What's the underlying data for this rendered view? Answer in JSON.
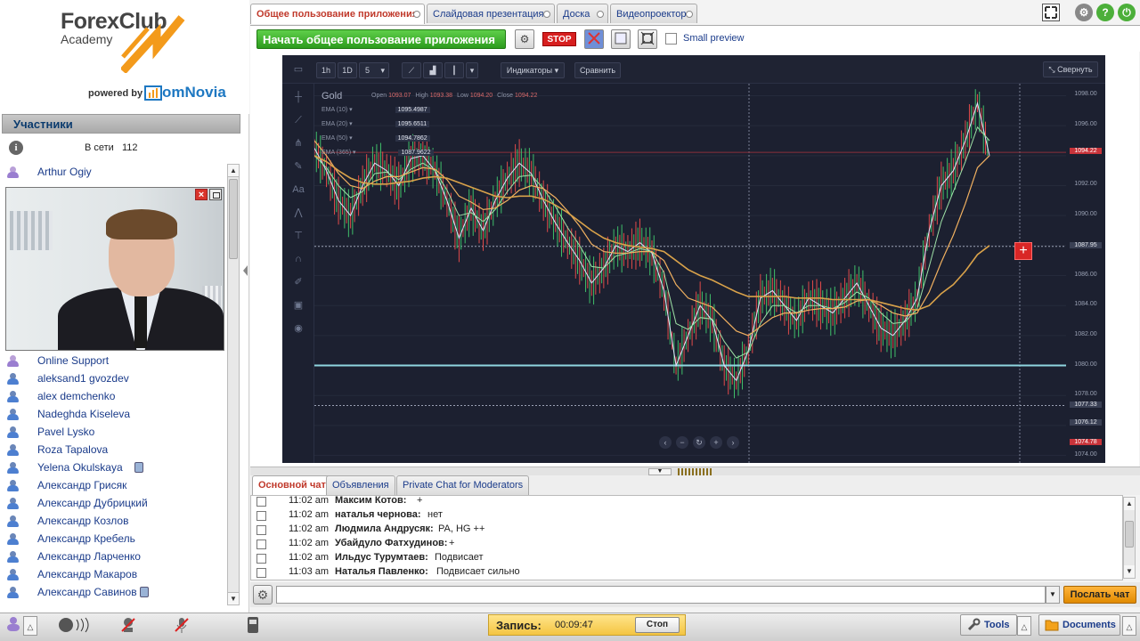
{
  "branding": {
    "logo_line1": "ForexClub",
    "logo_line2": "Academy",
    "powered_by": "powered by",
    "vendor": "omNovia"
  },
  "participants": {
    "title": "Участники",
    "online_label": "В сети",
    "online_count": "112",
    "presenter": "Arthur Ogiy",
    "list": [
      "Online Support",
      "aleksand1 gvozdev",
      "alex demchenko",
      "Nadeghda Kiseleva",
      "Pavel Lysko",
      "Roza Tapalova",
      "Yelena Okulskaya",
      "Александр Грисяк",
      "Александр Дубрицкий",
      "Александр Козлов",
      "Александр Кребель",
      "Александр Ларченко",
      "Александр Макаров",
      "Александр Савинов"
    ]
  },
  "tabs": [
    "Общее пользование приложения",
    "Слайдовая презентация",
    "Доска",
    "Видеопроектор"
  ],
  "share": {
    "start_label": "Начать общее пользование приложения",
    "stop_label": "STOP",
    "small_preview": "Small preview"
  },
  "chart_toolbar": {
    "tf1": "1h",
    "tf2": "1D",
    "tf3": "5",
    "indicators": "Индикаторы",
    "compare": "Сравнить",
    "collapse": "Свернуть"
  },
  "chart_legend": {
    "symbol": "Gold",
    "ohlc": [
      {
        "k": "Open",
        "v": "1093.07"
      },
      {
        "k": "High",
        "v": "1093.38"
      },
      {
        "k": "Low",
        "v": "1094.20"
      },
      {
        "k": "Close",
        "v": "1094.22"
      }
    ],
    "emas": [
      {
        "label": "EMA (10)",
        "value": "1095.4987"
      },
      {
        "label": "EMA (20)",
        "value": "1095.6511"
      },
      {
        "label": "EMA (50)",
        "value": "1094.7862"
      },
      {
        "label": "EMA (365)",
        "value": "1087.9622"
      }
    ]
  },
  "chart_data": {
    "type": "line",
    "title": "Gold",
    "y_ticks": [
      1098,
      1096,
      1094,
      1092,
      1090,
      1088,
      1086,
      1084,
      1082,
      1080,
      1078,
      1076,
      1074
    ],
    "y_tick_labels": [
      "1098.00",
      "1096.00",
      "1092.00",
      "1090.00",
      "1086.00",
      "1084.00",
      "1082.00",
      "1080.00",
      "1078.00",
      "1074.00"
    ],
    "price_labels": [
      {
        "text": "1094.22",
        "value": 1094.22,
        "style": "red"
      },
      {
        "text": "1087.95",
        "value": 1087.95,
        "style": "gray"
      },
      {
        "text": "1077.33",
        "value": 1077.33,
        "style": "gray"
      },
      {
        "text": "1076.12",
        "value": 1076.12,
        "style": "gray"
      },
      {
        "text": "1074.78",
        "value": 1074.78,
        "style": "red"
      }
    ],
    "horizontal_line": 1080.0,
    "ylim": [
      1073.5,
      1098.8
    ],
    "series": [
      {
        "values": [
          1094.5,
          1093.0,
          1091.0,
          1090.0,
          1092.0,
          1093.5,
          1093.0,
          1092.0,
          1093.8,
          1094.0,
          1093.0,
          1091.0,
          1088.5,
          1090.5,
          1089.0,
          1091.0,
          1092.5,
          1093.5,
          1092.8,
          1091.0,
          1089.5,
          1088.2,
          1087.0,
          1085.5,
          1086.5,
          1088.0,
          1087.6,
          1088.2,
          1087.5,
          1085.0,
          1080.0,
          1082.0,
          1084.0,
          1083.0,
          1080.0,
          1079.0,
          1081.0,
          1084.5,
          1085.0,
          1084.0,
          1083.0,
          1084.5,
          1084.0,
          1083.5,
          1084.5,
          1085.5,
          1084.0,
          1082.5,
          1082.0,
          1083.0,
          1084.5,
          1089.0,
          1092.0,
          1093.0,
          1095.0,
          1097.5,
          1094.0
        ]
      },
      {
        "values": [
          1094.0,
          1093.2,
          1092.0,
          1091.2,
          1091.6,
          1092.8,
          1092.9,
          1092.4,
          1093.1,
          1093.5,
          1093.0,
          1091.7,
          1090.0,
          1090.2,
          1089.6,
          1090.4,
          1091.6,
          1092.6,
          1092.7,
          1091.8,
          1090.6,
          1089.2,
          1088.0,
          1086.6,
          1086.5,
          1087.3,
          1087.5,
          1087.8,
          1087.6,
          1086.2,
          1082.8,
          1082.4,
          1083.2,
          1083.1,
          1081.6,
          1080.5,
          1080.9,
          1082.8,
          1084.0,
          1084.0,
          1083.5,
          1084.0,
          1084.0,
          1083.8,
          1084.2,
          1084.9,
          1084.5,
          1083.5,
          1082.8,
          1082.9,
          1083.8,
          1086.6,
          1089.6,
          1091.6,
          1093.6,
          1095.9,
          1095.0
        ]
      },
      {
        "values": [
          1095.0,
          1094.0,
          1092.8,
          1092.0,
          1091.8,
          1092.3,
          1092.6,
          1092.6,
          1092.9,
          1093.2,
          1093.1,
          1092.4,
          1091.3,
          1090.9,
          1090.4,
          1090.5,
          1091.0,
          1091.7,
          1092.0,
          1091.8,
          1091.2,
          1090.3,
          1089.3,
          1088.1,
          1087.6,
          1087.5,
          1087.5,
          1087.6,
          1087.6,
          1087.0,
          1085.4,
          1084.5,
          1084.2,
          1083.9,
          1083.1,
          1082.3,
          1082.0,
          1082.6,
          1083.2,
          1083.5,
          1083.5,
          1083.7,
          1083.8,
          1083.8,
          1083.9,
          1084.3,
          1084.4,
          1084.0,
          1083.5,
          1083.3,
          1083.5,
          1084.9,
          1086.9,
          1088.7,
          1090.8,
          1093.2,
          1094.0
        ]
      },
      {
        "values": [
          1094.0,
          1093.6,
          1093.0,
          1092.5,
          1092.2,
          1092.1,
          1092.1,
          1092.2,
          1092.3,
          1092.5,
          1092.6,
          1092.5,
          1092.2,
          1091.9,
          1091.6,
          1091.3,
          1091.2,
          1091.3,
          1091.3,
          1091.1,
          1090.7,
          1090.2,
          1089.6,
          1089.0,
          1088.5,
          1088.2,
          1088.0,
          1087.9,
          1087.8,
          1087.6,
          1087.0,
          1086.4,
          1086.0,
          1085.7,
          1085.3,
          1084.9,
          1084.6,
          1084.6,
          1084.6,
          1084.6,
          1084.5,
          1084.5,
          1084.5,
          1084.4,
          1084.4,
          1084.4,
          1084.4,
          1084.2,
          1084.0,
          1083.8,
          1083.7,
          1084.0,
          1084.8,
          1085.4,
          1086.3,
          1087.4,
          1088.0
        ]
      }
    ]
  },
  "chat": {
    "tabs": [
      "Основной чат",
      "Объявления",
      "Private Chat for Moderators"
    ],
    "messages": [
      {
        "time": "11:02 am",
        "author": "Максим Котов:",
        "text": "+"
      },
      {
        "time": "11:02 am",
        "author": "наталья чернова:",
        "text": "нет"
      },
      {
        "time": "11:02 am",
        "author": "Людмила Андрусяк:",
        "text": "PA, HG  ++"
      },
      {
        "time": "11:02 am",
        "author": "Убайдуло Фатхудинов:",
        "text": "+"
      },
      {
        "time": "11:02 am",
        "author": "Ильдус Турумтаев:",
        "text": "Подвисает"
      },
      {
        "time": "11:03 am",
        "author": "Наталья Павленко:",
        "text": "Подвисает сильно"
      }
    ],
    "send_label": "Послать чат",
    "input_value": ""
  },
  "recording": {
    "label": "Запись:",
    "time": "00:09:47",
    "stop_label": "Стоп"
  },
  "bottom": {
    "tools_label": "Tools",
    "documents_label": "Documents"
  },
  "colors": {
    "accent": "#c0392b",
    "link": "#1a3b8a",
    "chart_bg": "#1c2030",
    "ema10": "#e3e3ff",
    "ema20": "#9ee0a6",
    "ema50": "#f0b060",
    "ema365": "#d9a24a",
    "hline": "#8fd6e0"
  }
}
